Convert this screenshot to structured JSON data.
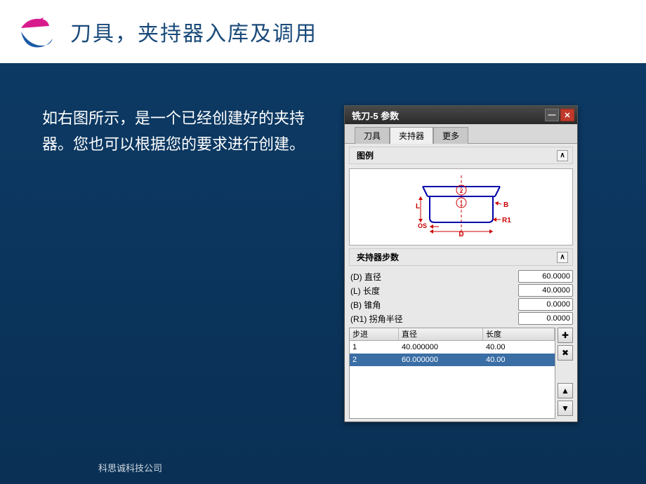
{
  "slide": {
    "title": "刀具，夹持器入库及调用",
    "body_text": "如右图所示，是一个已经创建好的夹持器。您也可以根据您的要求进行创建。",
    "footer": "科思诚科技公司"
  },
  "window": {
    "title": "铣刀-5 参数",
    "tabs": {
      "tool": "刀具",
      "holder": "夹持器",
      "more": "更多"
    },
    "legend_header": "图例",
    "steps_header": "夹持器步数",
    "params": {
      "diameter": {
        "label": "(D) 直径",
        "value": "60.0000"
      },
      "length": {
        "label": "(L) 长度",
        "value": "40.0000"
      },
      "taper": {
        "label": "(B) 锥角",
        "value": "0.0000"
      },
      "radius": {
        "label": "(R1) 拐角半径",
        "value": "0.0000"
      }
    },
    "table": {
      "headers": {
        "step": "步进",
        "diameter": "直径",
        "length": "长度"
      },
      "rows": [
        {
          "step": "1",
          "diameter": "40.000000",
          "length": "40.00"
        },
        {
          "step": "2",
          "diameter": "60.000000",
          "length": "40.00"
        }
      ]
    },
    "icons": {
      "add": "✚",
      "remove": "✖",
      "up": "▲",
      "down": "▼",
      "collapse": "∧"
    }
  }
}
